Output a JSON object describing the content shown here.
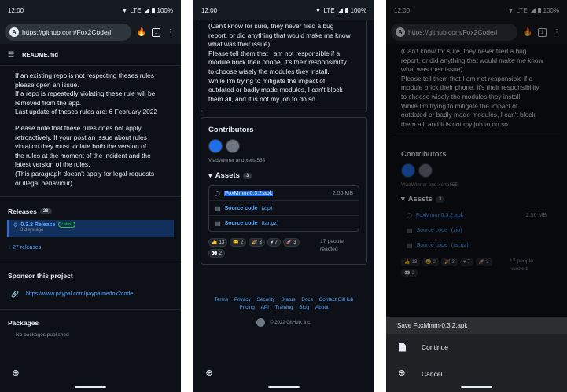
{
  "status": {
    "time": "12:00",
    "network": "LTE",
    "battery": "100%"
  },
  "browser": {
    "url": "https://github.com/Fox2Code/I",
    "tab_count": "1"
  },
  "panel1": {
    "readme_title": "README.md",
    "paragraph1": [
      "If an existing repo is not respecting theses rules",
      "please open an issue.",
      "If a repo is repeatedly violating these rule will be",
      "removed from the app.",
      "Last update of theses rules are: 6 February 2022"
    ],
    "paragraph2": [
      "Please note that these rules does not apply",
      "retroactively. If your post an issue about rules",
      "violation they must violate both the version of",
      "the rules at the moment of the incident and the",
      "latest version of the rules.",
      "(This paragraph doesn't apply for legal requests",
      "or illegal behaviour)"
    ],
    "releases_title": "Releases",
    "releases_count": "28",
    "release_name": "0.3.2 Release",
    "release_badge": "Latest",
    "release_date": "3 days ago",
    "more_releases": "+ 27 releases",
    "sponsor_title": "Sponsor this project",
    "sponsor_link": "https://www.paypal.com/paypalme/fox2code",
    "packages_title": "Packages",
    "packages_text": "No packages published"
  },
  "panel2": {
    "top_text": [
      "(Can't know for sure, they never filed a bug",
      "report, or did anything that would make me know",
      "what was their issue)",
      "Please tell them that I am not responsible if a",
      "module brick their phone, it's their responsibility",
      "to choose wisely the modules they install.",
      "While I'm trying to mitigate the impact of",
      "outdated or badly made modules, I can't block",
      "them all, and it is not my job to do so."
    ],
    "contributors_title": "Contributors",
    "contributors_names": "VladWinner and xerta555",
    "assets_title": "Assets",
    "assets_count": "3",
    "assets": [
      {
        "name": "FoxMmm-0.3.2.apk",
        "size": "2.56 MB",
        "icon": "package-icon"
      },
      {
        "name": "Source code",
        "ext": "(zip)",
        "icon": "file-zip-icon"
      },
      {
        "name": "Source code",
        "ext": "(tar.gz)",
        "icon": "file-zip-icon"
      }
    ],
    "reactions": [
      "13",
      "2",
      "3",
      "7",
      "3",
      "2"
    ],
    "reacted_text": [
      "17 people",
      "reacted"
    ],
    "footer_row1": [
      "Terms",
      "Privacy",
      "Security",
      "Status",
      "Docs",
      "Contact GitHub"
    ],
    "footer_row2": [
      "Pricing",
      "API",
      "Training",
      "Blog",
      "About"
    ],
    "copyright": "© 2022 GitHub, Inc."
  },
  "panel3": {
    "sheet_title": "Save FoxMmm-0.3.2.apk",
    "continue_label": "Continue",
    "cancel_label": "Cancel"
  },
  "colors": {
    "background": "#0d1117",
    "link": "#58a6ff",
    "highlight": "#1f6feb"
  }
}
